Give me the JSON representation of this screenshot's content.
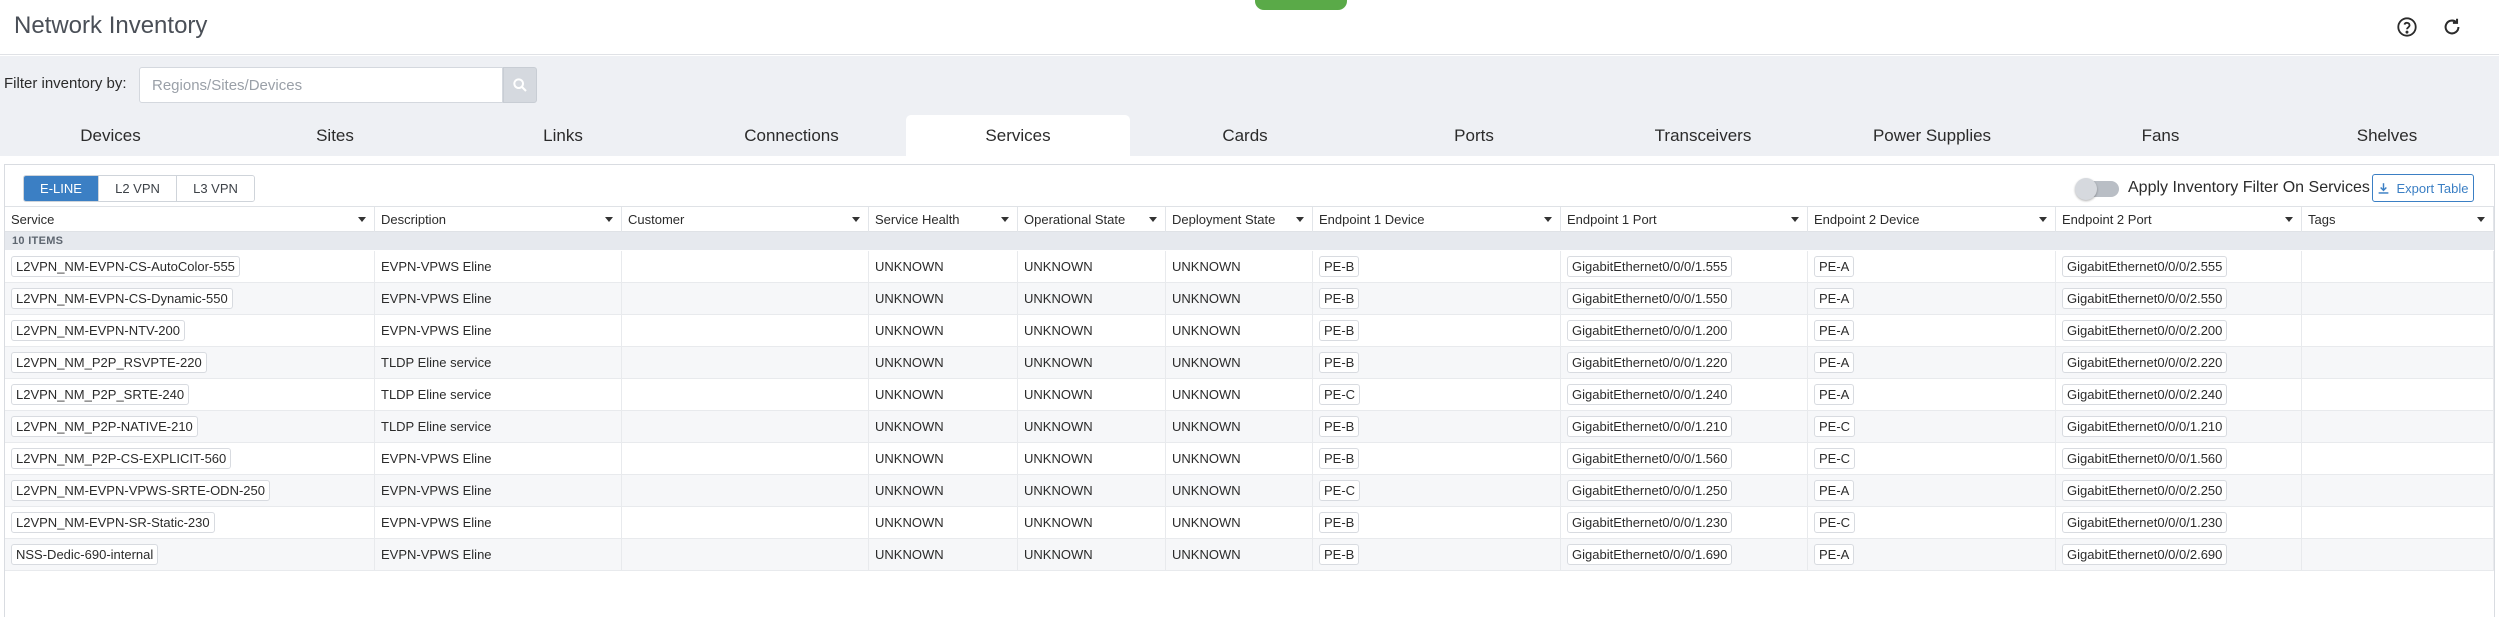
{
  "header": {
    "title": "Network Inventory",
    "help_icon": "help-circle-icon",
    "refresh_icon": "refresh-icon",
    "accent_color": "#5aaa48"
  },
  "filter": {
    "label": "Filter inventory by:",
    "placeholder": "Regions/Sites/Devices",
    "value": ""
  },
  "tabs": [
    {
      "label": "Devices",
      "active": false
    },
    {
      "label": "Sites",
      "active": false
    },
    {
      "label": "Links",
      "active": false
    },
    {
      "label": "Connections",
      "active": false
    },
    {
      "label": "Services",
      "active": true
    },
    {
      "label": "Cards",
      "active": false
    },
    {
      "label": "Ports",
      "active": false
    },
    {
      "label": "Transceivers",
      "active": false
    },
    {
      "label": "Power Supplies",
      "active": false
    },
    {
      "label": "Fans",
      "active": false
    },
    {
      "label": "Shelves",
      "active": false
    }
  ],
  "service_types": [
    {
      "label": "E-LINE",
      "active": true
    },
    {
      "label": "L2 VPN",
      "active": false
    },
    {
      "label": "L3 VPN",
      "active": false
    }
  ],
  "toolbar": {
    "apply_filter_label": "Apply Inventory Filter On Services",
    "apply_filter_on": false,
    "export_label": "Export Table",
    "primary_color": "#3b7fc4"
  },
  "table": {
    "columns": [
      "Service",
      "Description",
      "Customer",
      "Service Health",
      "Operational State",
      "Deployment State",
      "Endpoint 1 Device",
      "Endpoint 1 Port",
      "Endpoint 2 Device",
      "Endpoint 2 Port",
      "Tags"
    ],
    "group_label": "10 ITEMS",
    "rows": [
      {
        "service": "L2VPN_NM-EVPN-CS-AutoColor-555",
        "description": "EVPN-VPWS Eline",
        "customer": "",
        "health": "UNKNOWN",
        "op_state": "UNKNOWN",
        "deploy_state": "UNKNOWN",
        "ep1_device": "PE-B",
        "ep1_port": "GigabitEthernet0/0/0/1.555",
        "ep2_device": "PE-A",
        "ep2_port": "GigabitEthernet0/0/0/2.555",
        "tags": ""
      },
      {
        "service": "L2VPN_NM-EVPN-CS-Dynamic-550",
        "description": "EVPN-VPWS Eline",
        "customer": "",
        "health": "UNKNOWN",
        "op_state": "UNKNOWN",
        "deploy_state": "UNKNOWN",
        "ep1_device": "PE-B",
        "ep1_port": "GigabitEthernet0/0/0/1.550",
        "ep2_device": "PE-A",
        "ep2_port": "GigabitEthernet0/0/0/2.550",
        "tags": ""
      },
      {
        "service": "L2VPN_NM-EVPN-NTV-200",
        "description": "EVPN-VPWS Eline",
        "customer": "",
        "health": "UNKNOWN",
        "op_state": "UNKNOWN",
        "deploy_state": "UNKNOWN",
        "ep1_device": "PE-B",
        "ep1_port": "GigabitEthernet0/0/0/1.200",
        "ep2_device": "PE-A",
        "ep2_port": "GigabitEthernet0/0/0/2.200",
        "tags": ""
      },
      {
        "service": "L2VPN_NM_P2P_RSVPTE-220",
        "description": "TLDP Eline service",
        "customer": "",
        "health": "UNKNOWN",
        "op_state": "UNKNOWN",
        "deploy_state": "UNKNOWN",
        "ep1_device": "PE-B",
        "ep1_port": "GigabitEthernet0/0/0/1.220",
        "ep2_device": "PE-A",
        "ep2_port": "GigabitEthernet0/0/0/2.220",
        "tags": ""
      },
      {
        "service": "L2VPN_NM_P2P_SRTE-240",
        "description": "TLDP Eline service",
        "customer": "",
        "health": "UNKNOWN",
        "op_state": "UNKNOWN",
        "deploy_state": "UNKNOWN",
        "ep1_device": "PE-C",
        "ep1_port": "GigabitEthernet0/0/0/1.240",
        "ep2_device": "PE-A",
        "ep2_port": "GigabitEthernet0/0/0/2.240",
        "tags": ""
      },
      {
        "service": "L2VPN_NM_P2P-NATIVE-210",
        "description": "TLDP Eline service",
        "customer": "",
        "health": "UNKNOWN",
        "op_state": "UNKNOWN",
        "deploy_state": "UNKNOWN",
        "ep1_device": "PE-B",
        "ep1_port": "GigabitEthernet0/0/0/1.210",
        "ep2_device": "PE-C",
        "ep2_port": "GigabitEthernet0/0/0/1.210",
        "tags": ""
      },
      {
        "service": "L2VPN_NM_P2P-CS-EXPLICIT-560",
        "description": "EVPN-VPWS Eline",
        "customer": "",
        "health": "UNKNOWN",
        "op_state": "UNKNOWN",
        "deploy_state": "UNKNOWN",
        "ep1_device": "PE-B",
        "ep1_port": "GigabitEthernet0/0/0/1.560",
        "ep2_device": "PE-C",
        "ep2_port": "GigabitEthernet0/0/0/1.560",
        "tags": ""
      },
      {
        "service": "L2VPN_NM-EVPN-VPWS-SRTE-ODN-250",
        "description": "EVPN-VPWS Eline",
        "customer": "",
        "health": "UNKNOWN",
        "op_state": "UNKNOWN",
        "deploy_state": "UNKNOWN",
        "ep1_device": "PE-C",
        "ep1_port": "GigabitEthernet0/0/0/1.250",
        "ep2_device": "PE-A",
        "ep2_port": "GigabitEthernet0/0/0/2.250",
        "tags": ""
      },
      {
        "service": "L2VPN_NM-EVPN-SR-Static-230",
        "description": "EVPN-VPWS Eline",
        "customer": "",
        "health": "UNKNOWN",
        "op_state": "UNKNOWN",
        "deploy_state": "UNKNOWN",
        "ep1_device": "PE-B",
        "ep1_port": "GigabitEthernet0/0/0/1.230",
        "ep2_device": "PE-C",
        "ep2_port": "GigabitEthernet0/0/0/1.230",
        "tags": ""
      },
      {
        "service": "NSS-Dedic-690-internal",
        "description": "EVPN-VPWS Eline",
        "customer": "",
        "health": "UNKNOWN",
        "op_state": "UNKNOWN",
        "deploy_state": "UNKNOWN",
        "ep1_device": "PE-B",
        "ep1_port": "GigabitEthernet0/0/0/1.690",
        "ep2_device": "PE-A",
        "ep2_port": "GigabitEthernet0/0/0/2.690",
        "tags": ""
      }
    ]
  }
}
